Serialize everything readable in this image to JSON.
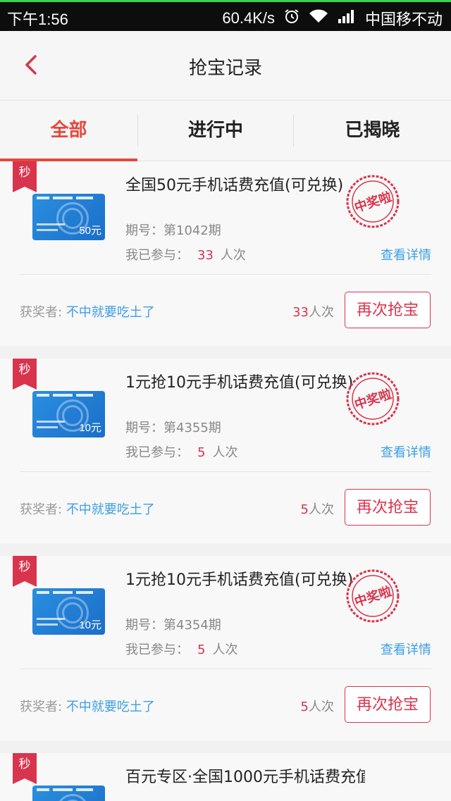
{
  "status": {
    "time": "下午1:56",
    "speed": "60.4K/s",
    "carrier": "中国移不动"
  },
  "nav": {
    "title": "抢宝记录"
  },
  "tabs": [
    {
      "label": "全部"
    },
    {
      "label": "进行中"
    },
    {
      "label": "已揭晓"
    }
  ],
  "labels": {
    "period_prefix": "期号：",
    "joined_prefix": "我已参与：",
    "joined_unit": "人次",
    "detail": "查看详情",
    "winner_prefix": "获奖者:",
    "count_unit": "人次",
    "again": "再次抢宝",
    "badge": "秒",
    "stamp": "中奖啦"
  },
  "colors": {
    "accent": "#e8473d",
    "badge": "#d9344d",
    "link": "#3d9fe6"
  },
  "records": [
    {
      "title": "全国50元手机话费充值(可兑换)",
      "card_value": "50元",
      "period": "第1042期",
      "joined": "33",
      "winner": "不中就要吃土了",
      "count": "33"
    },
    {
      "title": "1元抢10元手机话费充值(可兑换)",
      "card_value": "10元",
      "period": "第4355期",
      "joined": "5",
      "winner": "不中就要吃土了",
      "count": "5"
    },
    {
      "title": "1元抢10元手机话费充值(可兑换)",
      "card_value": "10元",
      "period": "第4354期",
      "joined": "5",
      "winner": "不中就要吃土了",
      "count": "5"
    },
    {
      "title": "百元专区·全国1000元手机话费充值",
      "card_value": "",
      "period": "",
      "joined": "",
      "winner": "",
      "count": ""
    }
  ]
}
